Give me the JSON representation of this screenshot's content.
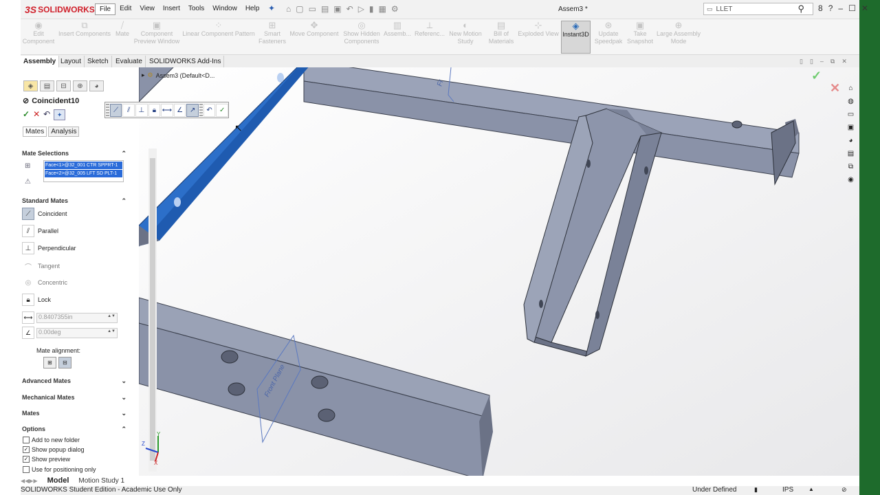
{
  "app": {
    "brand": "SOLIDWORKS",
    "brand_prefix": "3S",
    "doc_title": "Assem3 *"
  },
  "menu": [
    "File",
    "Edit",
    "View",
    "Insert",
    "Tools",
    "Window",
    "Help"
  ],
  "search": {
    "value": "LLET"
  },
  "top_right": [
    "8",
    "?",
    "–",
    "☐",
    "✕"
  ],
  "commands": [
    {
      "label": "Edit\nComponent",
      "icon": "edit-component-icon"
    },
    {
      "label": "Insert Components",
      "icon": "insert-components-icon"
    },
    {
      "label": "Mate",
      "icon": "mate-icon"
    },
    {
      "label": "Component\nPreview Window",
      "icon": "preview-window-icon"
    },
    {
      "label": "Linear Component Pattern",
      "icon": "linear-pattern-icon"
    },
    {
      "label": "Smart\nFasteners",
      "icon": "smart-fasteners-icon"
    },
    {
      "label": "Move Component",
      "icon": "move-component-icon"
    },
    {
      "label": "Show Hidden\nComponents",
      "icon": "show-hidden-icon"
    },
    {
      "label": "Assemb...",
      "icon": "assembly-features-icon"
    },
    {
      "label": "Referenc...",
      "icon": "reference-geometry-icon"
    },
    {
      "label": "New Motion\nStudy",
      "icon": "motion-study-icon"
    },
    {
      "label": "Bill of\nMaterials",
      "icon": "bom-icon"
    },
    {
      "label": "Exploded View",
      "icon": "exploded-view-icon"
    },
    {
      "label": "Instant3D",
      "icon": "instant3d-icon"
    },
    {
      "label": "Update\nSpeedpak",
      "icon": "speedpak-icon"
    },
    {
      "label": "Take\nSnapshot",
      "icon": "snapshot-icon"
    },
    {
      "label": "Large Assembly\nMode",
      "icon": "large-assembly-icon"
    }
  ],
  "tabs": [
    "Assembly",
    "Layout",
    "Sketch",
    "Evaluate",
    "SOLIDWORKS Add-Ins"
  ],
  "panel": {
    "title": "Coincident10",
    "subtabs": [
      "Mates",
      "Analysis"
    ],
    "mate_selections_header": "Mate Selections",
    "selections": [
      "Face<1>@32_001 CTR SPPRT-1",
      "Face<2>@32_005 LFT SD PLT-1"
    ],
    "standard_mates_header": "Standard Mates",
    "mates": [
      "Coincident",
      "Parallel",
      "Perpendicular",
      "Tangent",
      "Concentric",
      "Lock"
    ],
    "distance": "0.8407355in",
    "angle": "0.00deg",
    "mate_alignment": "Mate alignment:",
    "sections": [
      "Advanced Mates",
      "Mechanical Mates",
      "Mates",
      "Options"
    ],
    "options": [
      {
        "label": "Add to new folder",
        "checked": false
      },
      {
        "label": "Show popup dialog",
        "checked": true
      },
      {
        "label": "Show preview",
        "checked": true
      },
      {
        "label": "Use for positioning only",
        "checked": false
      }
    ]
  },
  "tree": {
    "label": "Assem3 (Default<D..."
  },
  "bottom_tabs": [
    "Model",
    "Motion Study 1"
  ],
  "status": {
    "left": "SOLIDWORKS Student Edition - Academic Use Only",
    "state": "Under Defined",
    "units": "IPS"
  },
  "plane_labels": [
    "Front Plane",
    "Fr"
  ],
  "colors": {
    "accent": "#2a6bd9",
    "steel": "#8a93aa",
    "highlight": "#2c6fc9",
    "green_bar": "#1e6b2c"
  }
}
